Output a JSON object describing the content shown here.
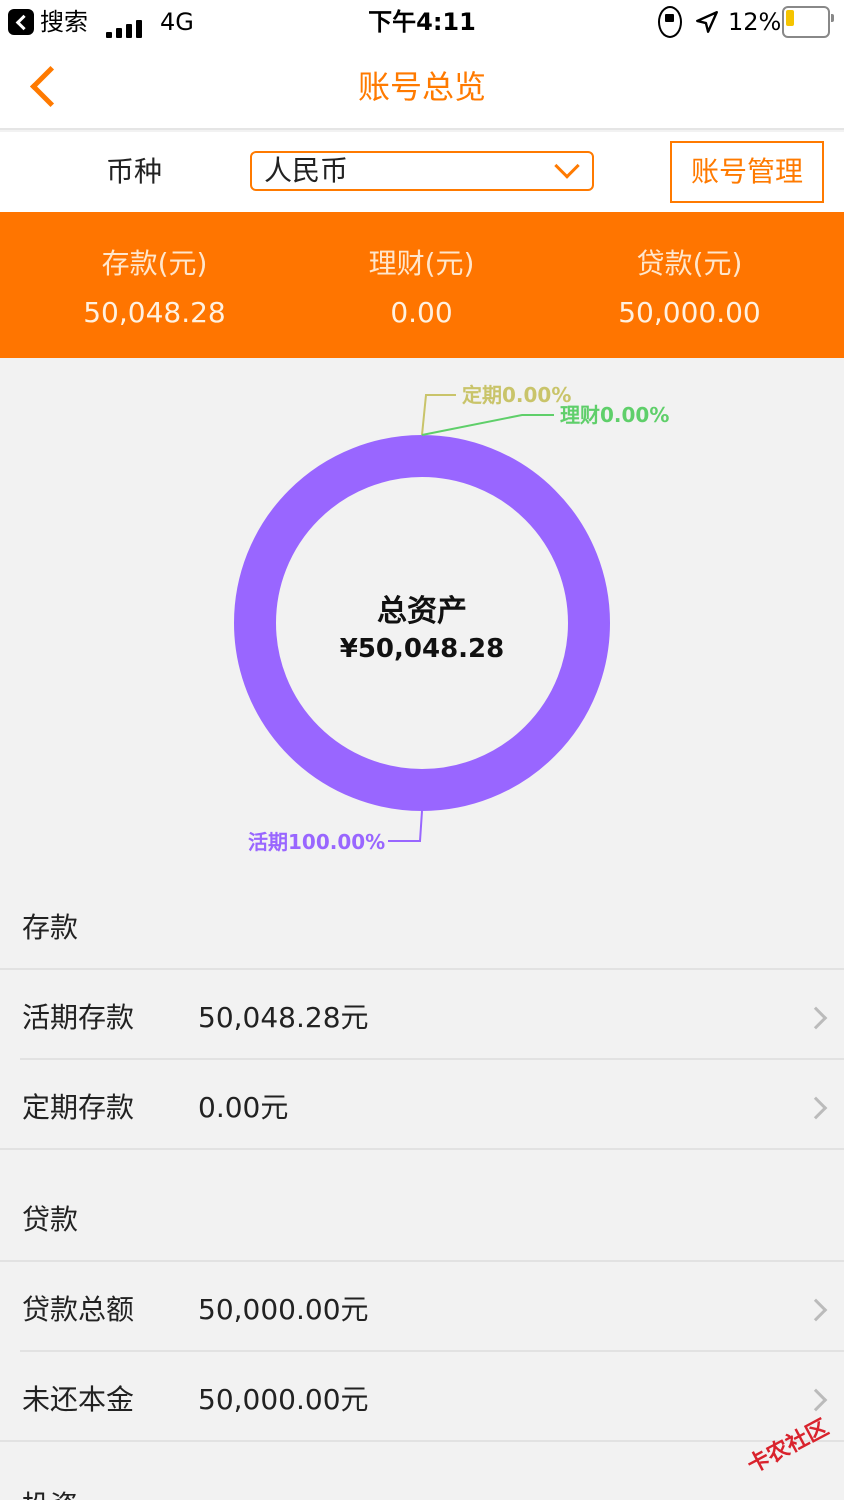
{
  "status_bar": {
    "back_app": "搜索",
    "network": "4G",
    "time": "下午4:11",
    "battery_percent": "12%",
    "battery_level": 0.12,
    "icons": [
      "signal-icon",
      "rotation-lock-icon",
      "location-icon",
      "battery-icon"
    ]
  },
  "navbar": {
    "title": "账号总览"
  },
  "currency": {
    "label": "币种",
    "selected": "人民币",
    "manage_button": "账号管理"
  },
  "summary": [
    {
      "label": "存款(元)",
      "amount": "50,048.28"
    },
    {
      "label": "理财(元)",
      "amount": "0.00"
    },
    {
      "label": "贷款(元)",
      "amount": "50,000.00"
    }
  ],
  "donut": {
    "center_title": "总资产",
    "center_amount": "¥50,048.28"
  },
  "chart_data": {
    "type": "pie",
    "categories": [
      "活期",
      "定期",
      "理财"
    ],
    "values": [
      100.0,
      0.0,
      0.0
    ],
    "labels": [
      "活期100.00%",
      "定期0.00%",
      "理财0.00%"
    ],
    "colors": [
      "#9966ff",
      "#c9c46a",
      "#5fcf6a"
    ],
    "title": "总资产",
    "center_text": "¥50,048.28"
  },
  "sections": {
    "deposit": {
      "title": "存款",
      "rows": [
        {
          "name": "活期存款",
          "value": "50,048.28元"
        },
        {
          "name": "定期存款",
          "value": "0.00元"
        }
      ]
    },
    "loan": {
      "title": "贷款",
      "rows": [
        {
          "name": "贷款总额",
          "value": "50,000.00元"
        },
        {
          "name": "未还本金",
          "value": "50,000.00元"
        }
      ]
    },
    "partial_title": "投资"
  },
  "watermark": {
    "text": "卡农社区"
  },
  "colors": {
    "accent": "#ff7a00",
    "summary_bg": "#ff7500",
    "donut": "#9966ff",
    "page_bg": "#f2f2f2"
  }
}
